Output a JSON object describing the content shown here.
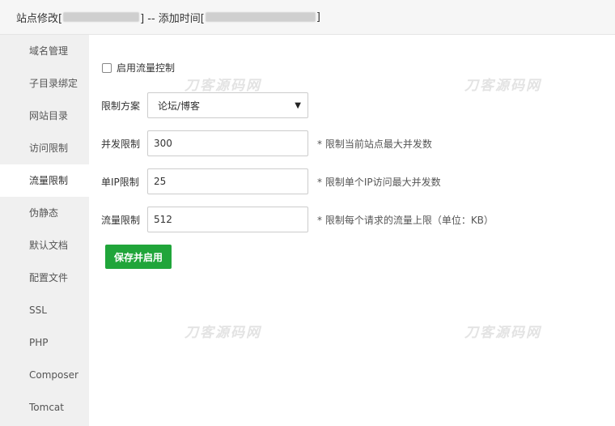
{
  "titlebar": {
    "prefix": "站点修改[",
    "middle": "] -- 添加时间[",
    "suffix": "]"
  },
  "sidebar": {
    "items": [
      {
        "label": "域名管理"
      },
      {
        "label": "子目录绑定"
      },
      {
        "label": "网站目录"
      },
      {
        "label": "访问限制"
      },
      {
        "label": "流量限制",
        "active": true
      },
      {
        "label": "伪静态"
      },
      {
        "label": "默认文档"
      },
      {
        "label": "配置文件"
      },
      {
        "label": "SSL"
      },
      {
        "label": "PHP"
      },
      {
        "label": "Composer"
      },
      {
        "label": "Tomcat"
      }
    ]
  },
  "form": {
    "enable_label": "启用流量控制",
    "enable_checked": false,
    "scheme_label": "限制方案",
    "scheme_value": "论坛/博客",
    "concurrency_label": "并发限制",
    "concurrency_value": "300",
    "concurrency_hint": "* 限制当前站点最大并发数",
    "per_ip_label": "单IP限制",
    "per_ip_value": "25",
    "per_ip_hint": "* 限制单个IP访问最大并发数",
    "rate_label": "流量限制",
    "rate_value": "512",
    "rate_hint": "* 限制每个请求的流量上限（单位：KB）",
    "submit_label": "保存并启用"
  },
  "watermark": "刀客源码网",
  "colors": {
    "primary": "#20a53a",
    "sidebar_bg": "#f0f0f0",
    "titlebar_bg": "#f6f6f6"
  }
}
